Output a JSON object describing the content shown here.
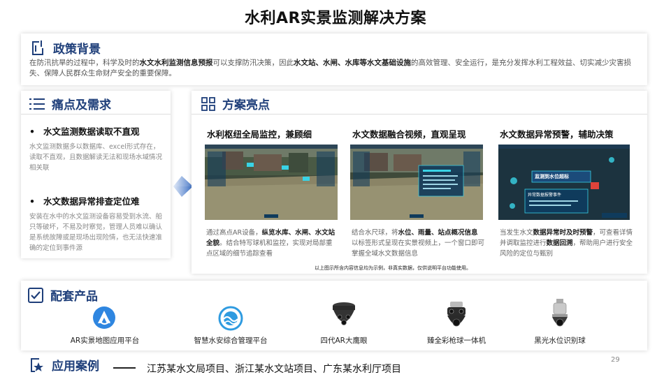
{
  "page_title": "水利AR实景监测解决方案",
  "policy": {
    "heading": "政策背景",
    "text_parts": [
      {
        "t": "在防汛抗旱的过程中，科学及时的",
        "b": false
      },
      {
        "t": "水文水利监测信息预报",
        "b": true
      },
      {
        "t": "可以支撑防汛决策，因此",
        "b": false
      },
      {
        "t": "水文站、水闸、水库等水文基础设施",
        "b": true
      },
      {
        "t": "的高效管理、安全运行，是充分发挥水利工程效益、切实减少灾害损失、保障人民群众生命财产安全的重要保障。",
        "b": false
      }
    ]
  },
  "pain": {
    "heading": "痛点及需求",
    "items": [
      {
        "title": "水文监测数据读取不直观",
        "text": "水文监测数据多以数据库、excel形式存在，读取不直观，且数据解读无法和现场水域情况相关联"
      },
      {
        "title": "水文数据异常排查定位难",
        "text": "安装在水中的水文监测设备容易受到水流、船只等破坏，不易及时察觉，管理人员难以确认是系统故障或是现场出现险情，也无法快速准确的定位到事件源"
      }
    ]
  },
  "highlights": {
    "heading": "方案亮点",
    "cards": [
      {
        "title": "水利枢纽全局监控，兼顾细",
        "desc": [
          {
            "t": "通过高点AR设备，",
            "b": false
          },
          {
            "t": "纵览水库、水闸、水文站全貌",
            "b": true
          },
          {
            "t": "。结合特写球机和监控，实现对局部重点区域的细节追踪查看",
            "b": false
          }
        ]
      },
      {
        "title": "水文数据融合视频，直观呈现",
        "desc": [
          {
            "t": "结合水尺球，将",
            "b": false
          },
          {
            "t": "水位、雨量、站点概况信息",
            "b": true
          },
          {
            "t": "以标签形式呈现在实景视频上，一个窗口即可掌握全域水文数据信息",
            "b": false
          }
        ]
      },
      {
        "title": "水文数据异常预警，辅助决策",
        "desc": [
          {
            "t": "当发生水文",
            "b": false
          },
          {
            "t": "数据异常时及时预警",
            "b": true
          },
          {
            "t": "，可查看详情并调取监控进行",
            "b": false
          },
          {
            "t": "数据回溯",
            "b": true
          },
          {
            "t": "，帮助用户进行安全风险的定位与甄别",
            "b": false
          }
        ]
      }
    ],
    "overlay_labels": {
      "alarm_title": "监测到水位超标",
      "event_title": "异常数据报警事件"
    },
    "disclaimer": "以上图示所含内容信息均为示例，非真实数据，仅供说明平台功能使用。"
  },
  "products": {
    "heading": "配套产品",
    "items": [
      {
        "label": "AR实景地图应用平台",
        "icon": "ar-map-logo-icon"
      },
      {
        "label": "智慧水安综合管理平台",
        "icon": "water-safety-logo-icon"
      },
      {
        "label": "四代AR大鹰眼",
        "icon": "ar-eagle-eye-camera-icon"
      },
      {
        "label": "臻全彩枪球一体机",
        "icon": "bullet-dome-camera-icon"
      },
      {
        "label": "黑光水位识别球",
        "icon": "water-level-dome-camera-icon"
      }
    ]
  },
  "cases": {
    "heading": "应用案例",
    "text": "江苏某水文局项目、浙江某水文站项目、广东某水利厅项目"
  },
  "page_number": "29",
  "colors": {
    "heading_blue": "#1f3f7a",
    "accent_blue": "#2f6fd6",
    "arrow_blue": "#3b6fc4"
  }
}
